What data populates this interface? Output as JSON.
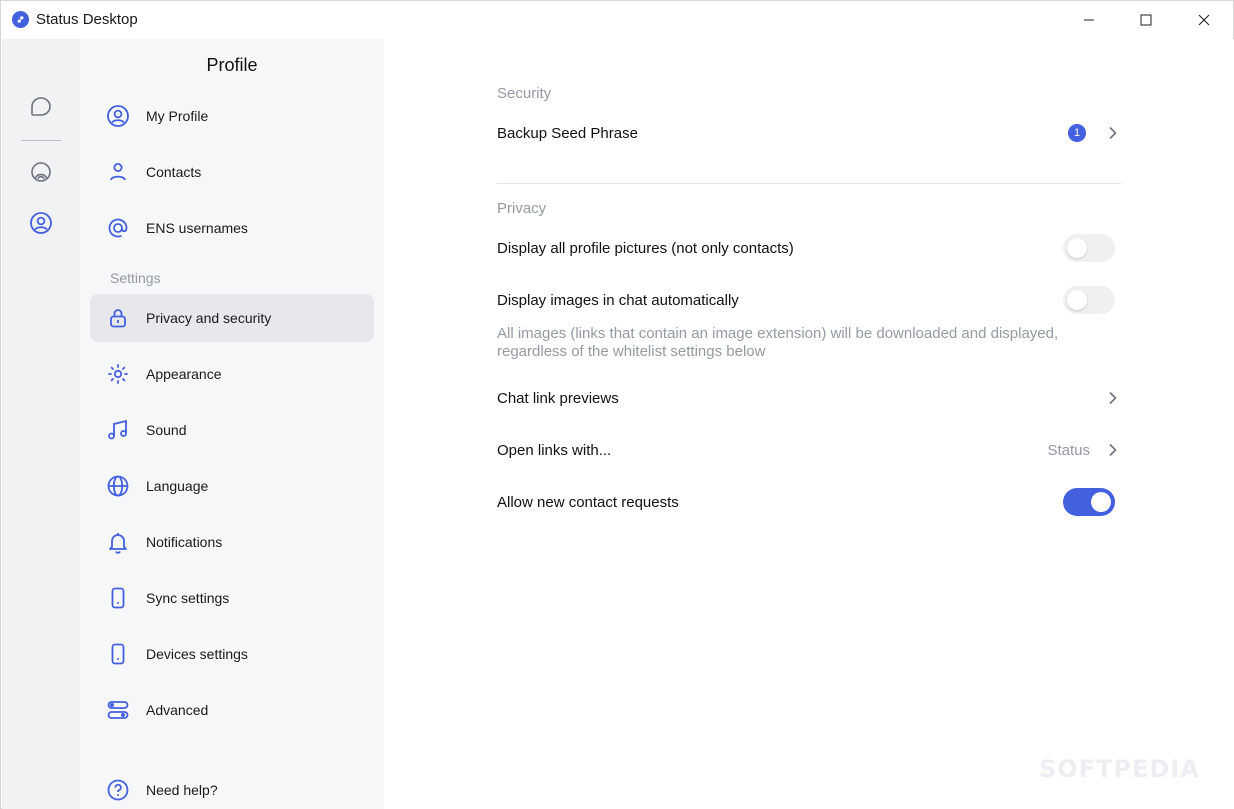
{
  "window": {
    "title": "Status Desktop",
    "controls": [
      "minimize",
      "maximize",
      "close"
    ]
  },
  "rail": {
    "items": [
      {
        "icon": "chat-icon"
      },
      {
        "icon": "communities-icon"
      },
      {
        "icon": "profile-icon"
      }
    ]
  },
  "sidebar": {
    "title": "Profile",
    "items_top": [
      {
        "label": "My Profile",
        "icon": "user-circle-icon"
      },
      {
        "label": "Contacts",
        "icon": "contact-icon"
      },
      {
        "label": "ENS usernames",
        "icon": "at-sign-icon"
      }
    ],
    "settings_label": "Settings",
    "items_settings": [
      {
        "label": "Privacy and security",
        "icon": "lock-icon",
        "active": true
      },
      {
        "label": "Appearance",
        "icon": "sun-icon"
      },
      {
        "label": "Sound",
        "icon": "music-note-icon"
      },
      {
        "label": "Language",
        "icon": "globe-icon"
      },
      {
        "label": "Notifications",
        "icon": "bell-icon"
      },
      {
        "label": "Sync settings",
        "icon": "phone-icon"
      },
      {
        "label": "Devices settings",
        "icon": "phone-icon"
      },
      {
        "label": "Advanced",
        "icon": "sliders-icon"
      }
    ],
    "help_label": "Need help?"
  },
  "main": {
    "security": {
      "label": "Security",
      "backup_label": "Backup Seed Phrase",
      "backup_badge": "1"
    },
    "privacy": {
      "label": "Privacy",
      "display_pictures_label": "Display all profile pictures (not only contacts)",
      "display_pictures_on": false,
      "display_images_label": "Display images in chat automatically",
      "display_images_on": false,
      "display_images_note": "All images (links that contain an image extension) will be downloaded and displayed, regardless of the whitelist settings below",
      "link_previews_label": "Chat link previews",
      "open_links_label": "Open links with...",
      "open_links_value": "Status",
      "contact_requests_label": "Allow new contact requests",
      "contact_requests_on": true
    }
  },
  "watermark": "SOFTPEDIA",
  "colors": {
    "accent": "#4360df",
    "muted_text": "#939ba1",
    "rail_bg": "#f1f2f4",
    "sidebar_bg": "#f6f7f9",
    "active_item_bg": "#e6e8ec"
  }
}
